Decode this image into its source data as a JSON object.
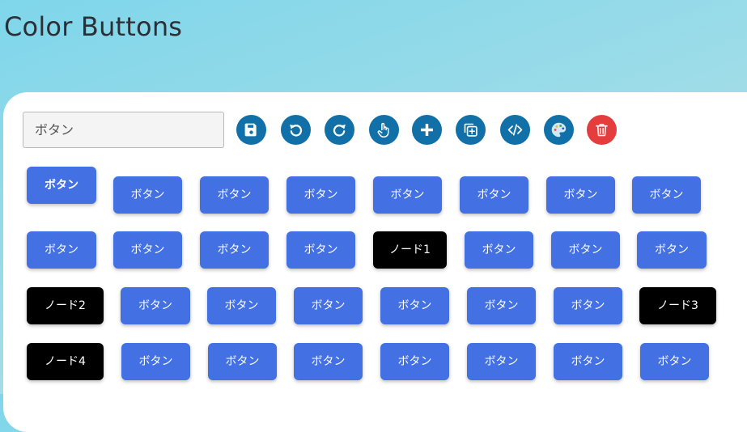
{
  "page": {
    "title": "Color Buttons"
  },
  "input": {
    "value": "ボタン"
  },
  "toolbar": {
    "items": [
      {
        "name": "save-icon"
      },
      {
        "name": "undo-icon"
      },
      {
        "name": "redo-icon"
      },
      {
        "name": "hand-pointer-icon"
      },
      {
        "name": "plus-icon"
      },
      {
        "name": "copy-add-icon"
      },
      {
        "name": "code-icon"
      },
      {
        "name": "palette-icon"
      },
      {
        "name": "trash-icon"
      }
    ],
    "colors": {
      "primary": "#1170a8",
      "danger": "#e53d3d"
    }
  },
  "buttons": {
    "colors": {
      "default": "#4370e3",
      "node": "#000000"
    },
    "rows": [
      [
        "ボタン",
        "ボタン",
        "ボタン",
        "ボタン",
        "ボタン",
        "ボタン",
        "ボタン",
        "ボタン"
      ],
      [
        "ボタン",
        "ボタン",
        "ボタン",
        "ボタン",
        "ノード1",
        "ボタン",
        "ボタン",
        "ボタン"
      ],
      [
        "ノード2",
        "ボタン",
        "ボタン",
        "ボタン",
        "ボタン",
        "ボタン",
        "ボタン",
        "ノード3"
      ],
      [
        "ノード4",
        "ボタン",
        "ボタン",
        "ボタン",
        "ボタン",
        "ボタン",
        "ボタン",
        "ボタン"
      ]
    ]
  }
}
